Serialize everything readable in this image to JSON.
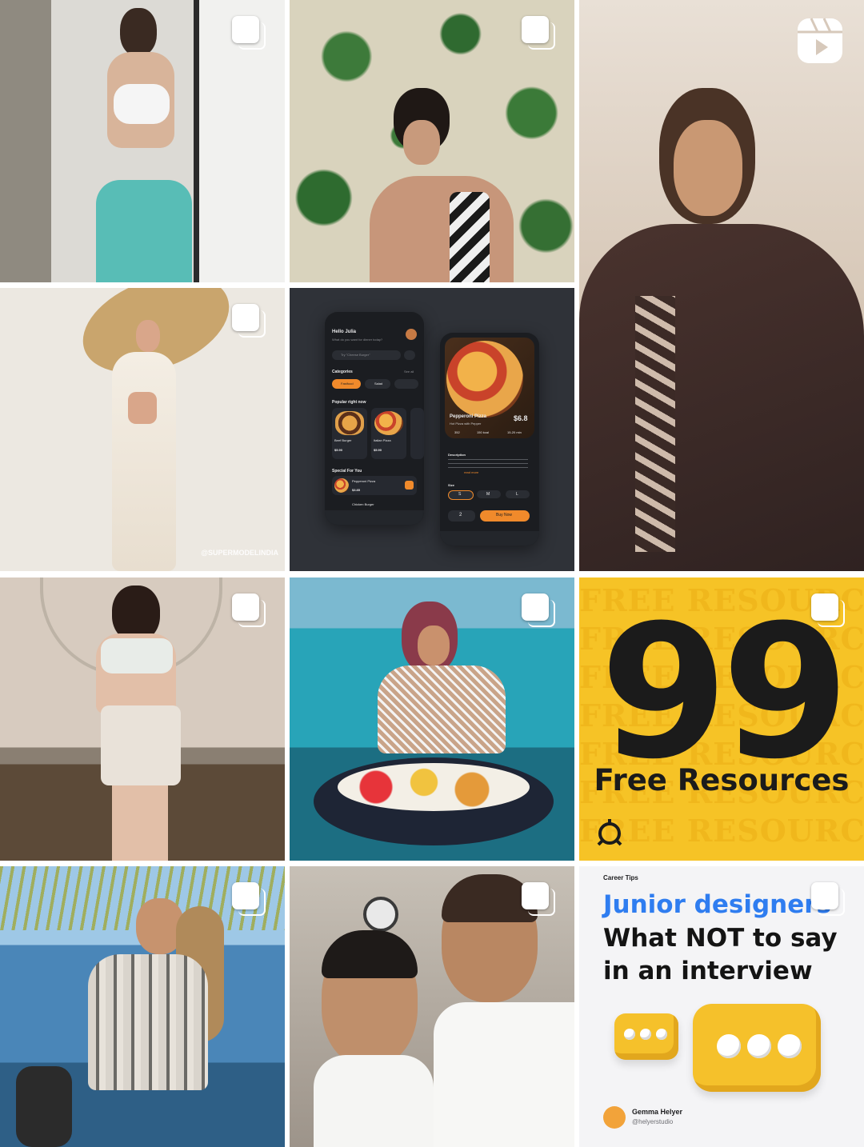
{
  "grid": {
    "posts": [
      {
        "id": "post-1",
        "type": "carousel",
        "alt": "Woman in white sports top"
      },
      {
        "id": "post-2",
        "type": "carousel",
        "alt": "Woman in front of leaf wall"
      },
      {
        "id": "post-3",
        "type": "reel",
        "alt": "Woman in brown ethnic outfit"
      },
      {
        "id": "post-4",
        "type": "carousel",
        "alt": "Woman in large sun hat",
        "watermark": "@SUPERMODELINDIA"
      },
      {
        "id": "post-5",
        "type": "carousel",
        "alt": "Food app UI design"
      },
      {
        "id": "post-7",
        "type": "carousel",
        "alt": "Mirror selfie"
      },
      {
        "id": "post-8",
        "type": "carousel",
        "alt": "Floating breakfast in pool"
      },
      {
        "id": "post-9",
        "type": "carousel",
        "alt": "Free resources graphic"
      },
      {
        "id": "post-10",
        "type": "carousel",
        "alt": "Woman by the lake"
      },
      {
        "id": "post-11",
        "type": "carousel",
        "alt": "Two men selfie"
      },
      {
        "id": "post-12",
        "type": "carousel",
        "alt": "Career tips graphic"
      }
    ]
  },
  "food_app": {
    "greeting": "Hello Julia",
    "question": "What do you want for dinner today?",
    "search_placeholder": "Try \"Cheese Burger\"",
    "categories_title": "Categories",
    "see_all": "See all",
    "cat_active": "Fastfood",
    "cat_2": "Salad",
    "popular_title": "Popular right now",
    "item1_name": "Beef Burger",
    "item1_price": "$5.90",
    "item2_name": "Italian Pizza",
    "item2_price": "$5.90",
    "special_title": "Special For You",
    "special_name": "Pepperoni Pizza",
    "special_price": "$3.85",
    "next_item": "Chicken Burger",
    "detail_name": "Pepperoni Pizza",
    "detail_sub": "Hot Pizza with Pepper",
    "detail_price": "$6.8",
    "rating": "352",
    "kcal": "150 kcal",
    "time": "15-20 min",
    "desc_title": "Description",
    "read_more": "read more",
    "size_title": "Size",
    "sizes": [
      "S",
      "M",
      "L"
    ],
    "qty": "2",
    "buy_label": "Buy Now"
  },
  "free_resources": {
    "ghost_text": "FREE RESOURCES",
    "number": "99",
    "label": "Free Resources"
  },
  "career": {
    "tag": "Career Tips",
    "title_1": "Junior designers",
    "title_2": "What NOT to say in an interview",
    "author": "Gemma Helyer",
    "handle": "@helyerstudio"
  },
  "colors": {
    "accent_orange": "#f08a2b",
    "accent_blue": "#2f7df0",
    "accent_yellow": "#f6c326"
  }
}
